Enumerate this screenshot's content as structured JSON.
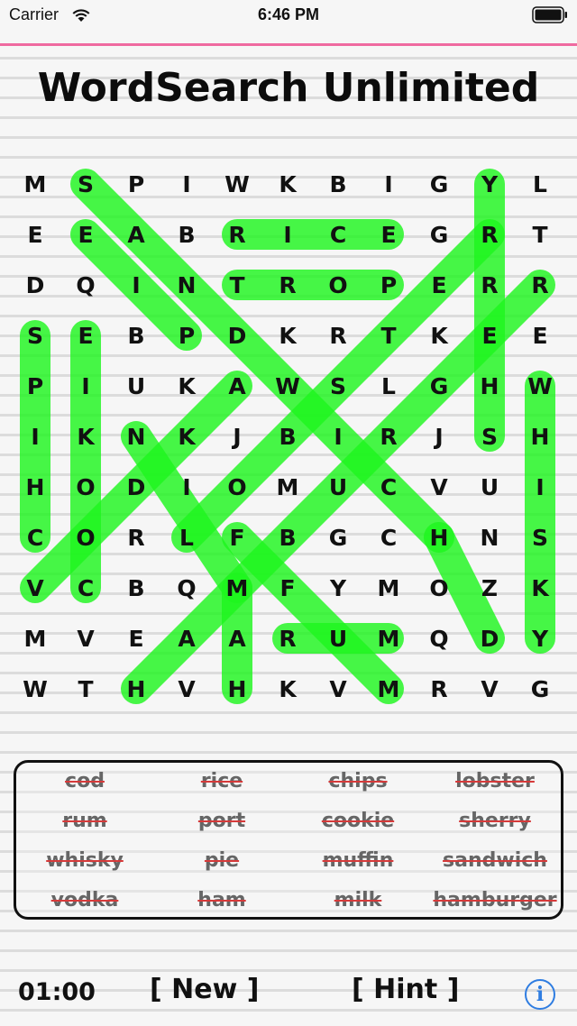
{
  "status_bar": {
    "carrier": "Carrier",
    "time": "6:46 PM"
  },
  "title": "WordSearch Unlimited",
  "grid": [
    [
      "M",
      "S",
      "P",
      "I",
      "W",
      "K",
      "B",
      "I",
      "G",
      "Y",
      "L"
    ],
    [
      "E",
      "E",
      "A",
      "B",
      "R",
      "I",
      "C",
      "E",
      "G",
      "R",
      "T"
    ],
    [
      "D",
      "Q",
      "I",
      "N",
      "T",
      "R",
      "O",
      "P",
      "E",
      "R",
      "R"
    ],
    [
      "S",
      "E",
      "B",
      "P",
      "D",
      "K",
      "R",
      "T",
      "K",
      "E",
      "E"
    ],
    [
      "P",
      "I",
      "U",
      "K",
      "A",
      "W",
      "S",
      "L",
      "G",
      "H",
      "W"
    ],
    [
      "I",
      "K",
      "N",
      "K",
      "J",
      "B",
      "I",
      "R",
      "J",
      "S",
      "H"
    ],
    [
      "H",
      "O",
      "D",
      "I",
      "O",
      "M",
      "U",
      "C",
      "V",
      "U",
      "I"
    ],
    [
      "C",
      "O",
      "R",
      "L",
      "F",
      "B",
      "G",
      "C",
      "H",
      "N",
      "S"
    ],
    [
      "V",
      "C",
      "B",
      "Q",
      "M",
      "F",
      "Y",
      "M",
      "O",
      "Z",
      "K"
    ],
    [
      "M",
      "V",
      "E",
      "A",
      "A",
      "R",
      "U",
      "M",
      "Q",
      "D",
      "Y"
    ],
    [
      "W",
      "T",
      "H",
      "V",
      "H",
      "K",
      "V",
      "M",
      "R",
      "V",
      "G"
    ]
  ],
  "found_words": [
    {
      "word": "rice",
      "start": [
        1,
        4
      ],
      "end": [
        1,
        7
      ]
    },
    {
      "word": "port",
      "start": [
        2,
        7
      ],
      "end": [
        2,
        4
      ]
    },
    {
      "word": "rum",
      "start": [
        9,
        5
      ],
      "end": [
        9,
        7
      ]
    },
    {
      "word": "sherry",
      "start": [
        5,
        9
      ],
      "end": [
        0,
        9
      ]
    },
    {
      "word": "whisky",
      "start": [
        4,
        10
      ],
      "end": [
        9,
        10
      ]
    },
    {
      "word": "chips",
      "start": [
        7,
        0
      ],
      "end": [
        3,
        0
      ]
    },
    {
      "word": "vodka",
      "start": [
        8,
        1
      ],
      "end": [
        3,
        1
      ]
    },
    {
      "word": "ham",
      "start": [
        10,
        4
      ],
      "end": [
        8,
        4
      ]
    },
    {
      "word": "lobster",
      "start": [
        7,
        3
      ],
      "end": [
        1,
        9
      ]
    },
    {
      "word": "hamburger",
      "start": [
        10,
        2
      ],
      "end": [
        2,
        10
      ]
    },
    {
      "word": "sandwich",
      "start": [
        0,
        1
      ],
      "end": [
        7,
        8
      ]
    },
    {
      "word": "pie",
      "start": [
        3,
        3
      ],
      "end": [
        1,
        1
      ]
    },
    {
      "word": "muffin",
      "start": [
        8,
        4
      ],
      "end": [
        5,
        2
      ]
    },
    {
      "word": "cookie",
      "start": [
        8,
        0
      ],
      "end": [
        4,
        4
      ]
    },
    {
      "word": "milk",
      "start": [
        10,
        7
      ],
      "end": [
        7,
        4
      ]
    },
    {
      "word": "cod",
      "start": [
        7,
        8
      ],
      "end": [
        9,
        9
      ]
    }
  ],
  "highlight_color": "#1ff51f",
  "word_list": [
    [
      "cod",
      "rice",
      "chips",
      "lobster"
    ],
    [
      "rum",
      "port",
      "cookie",
      "sherry"
    ],
    [
      "whisky",
      "pie",
      "muffin",
      "sandwich"
    ],
    [
      "vodka",
      "ham",
      "milk",
      "hamburger"
    ]
  ],
  "bottom": {
    "timer": "01:00",
    "new_label": "[ New ]",
    "hint_label": "[ Hint ]",
    "info_label": "i"
  }
}
